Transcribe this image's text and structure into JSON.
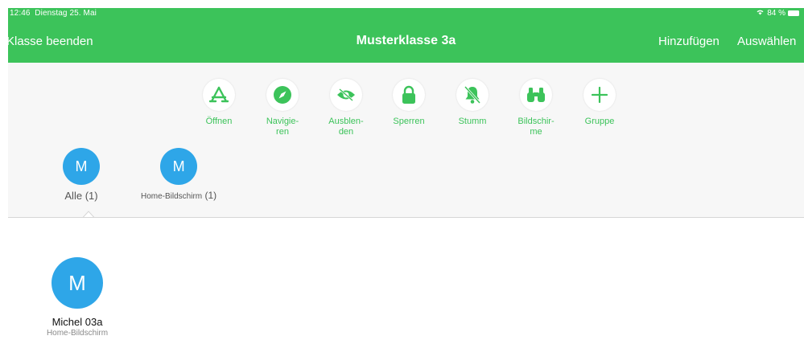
{
  "status": {
    "time": "12:46",
    "date": "Dienstag 25. Mai",
    "battery": "84 %"
  },
  "header": {
    "end_class": "Klasse beenden",
    "title": "Musterklasse 3a",
    "add": "Hinzufügen",
    "select": "Auswählen"
  },
  "actions": [
    {
      "label": "Öffnen",
      "icon": "app-store-icon"
    },
    {
      "label": "Navigie-\nren",
      "icon": "compass-icon"
    },
    {
      "label": "Ausblen-\nden",
      "icon": "eye-hidden-icon"
    },
    {
      "label": "Sperren",
      "icon": "lock-icon"
    },
    {
      "label": "Stumm",
      "icon": "bell-muted-icon"
    },
    {
      "label": "Bildschir-\nme",
      "icon": "binoculars-icon"
    },
    {
      "label": "Gruppe",
      "icon": "plus-icon"
    }
  ],
  "groups": [
    {
      "initial": "M",
      "name": "Alle",
      "count": "(1)"
    },
    {
      "initial": "M",
      "name": "Home-Bildschirm",
      "count": "(1)"
    }
  ],
  "students": [
    {
      "initial": "M",
      "name": "Michel 03a",
      "status": "Home-Bildschirm"
    }
  ],
  "colors": {
    "accent": "#3cc35a",
    "avatar": "#2ea6e8",
    "background": "#f7f7f7"
  }
}
